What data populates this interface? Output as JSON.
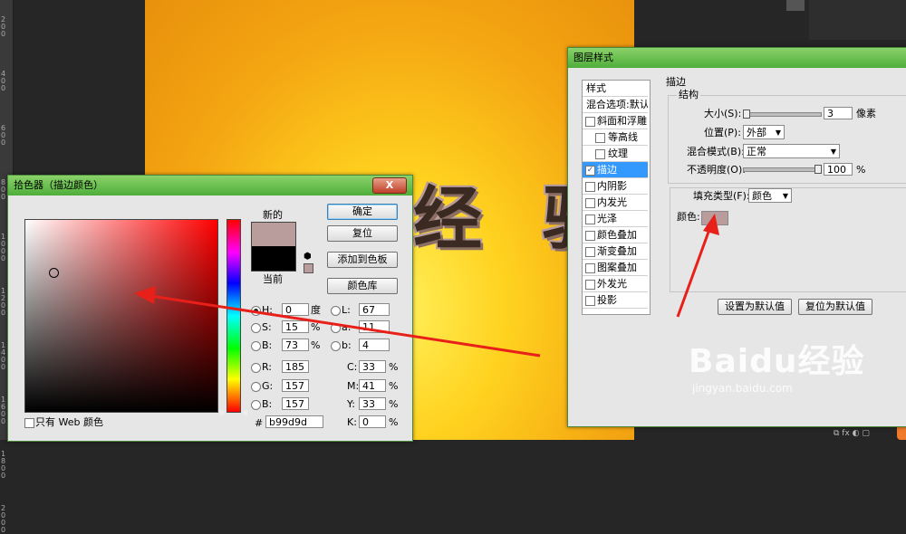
{
  "background": {
    "canvas_text": "经 验",
    "ruler_marks": [
      "200",
      "400",
      "600",
      "800",
      "1000",
      "1200",
      "1400",
      "1600",
      "1800",
      "2000"
    ],
    "watermark_main": "Baidu经验",
    "watermark_url": "jingyan.baidu.com"
  },
  "picker": {
    "title": "拾色器（描边颜色）",
    "close_label": "X",
    "new_label": "新的",
    "current_label": "当前",
    "new_color": "#b99d9d",
    "current_color": "#000000",
    "ok_label": "确定",
    "reset_label": "复位",
    "add_swatch_label": "添加到色板",
    "library_label": "颜色库",
    "web_only_label": "只有 Web 颜色",
    "hsb": [
      {
        "label": "H:",
        "value": "0",
        "unit": "度"
      },
      {
        "label": "S:",
        "value": "15",
        "unit": "%"
      },
      {
        "label": "B:",
        "value": "73",
        "unit": "%"
      }
    ],
    "rgb": [
      {
        "label": "R:",
        "value": "185"
      },
      {
        "label": "G:",
        "value": "157"
      },
      {
        "label": "B:",
        "value": "157"
      }
    ],
    "lab": [
      {
        "label": "L:",
        "value": "67"
      },
      {
        "label": "a:",
        "value": "11"
      },
      {
        "label": "b:",
        "value": "4"
      }
    ],
    "cmyk": [
      {
        "label": "C:",
        "value": "33",
        "unit": "%"
      },
      {
        "label": "M:",
        "value": "41",
        "unit": "%"
      },
      {
        "label": "Y:",
        "value": "33",
        "unit": "%"
      },
      {
        "label": "K:",
        "value": "0",
        "unit": "%"
      }
    ],
    "hex_label": "#",
    "hex_value": "b99d9d"
  },
  "layer_style": {
    "title": "图层样式",
    "sidebar_header": "样式",
    "blend_options": "混合选项:默认",
    "effects": [
      {
        "label": "斜面和浮雕",
        "checked": false,
        "indent": false
      },
      {
        "label": "等高线",
        "checked": false,
        "indent": true
      },
      {
        "label": "纹理",
        "checked": false,
        "indent": true
      },
      {
        "label": "描边",
        "checked": true,
        "indent": false
      },
      {
        "label": "内阴影",
        "checked": false,
        "indent": false
      },
      {
        "label": "内发光",
        "checked": false,
        "indent": false
      },
      {
        "label": "光泽",
        "checked": false,
        "indent": false
      },
      {
        "label": "颜色叠加",
        "checked": false,
        "indent": false
      },
      {
        "label": "渐变叠加",
        "checked": false,
        "indent": false
      },
      {
        "label": "图案叠加",
        "checked": false,
        "indent": false
      },
      {
        "label": "外发光",
        "checked": false,
        "indent": false
      },
      {
        "label": "投影",
        "checked": false,
        "indent": false
      }
    ],
    "section_title": "描边",
    "structure_title": "结构",
    "size_label": "大小(S):",
    "size_value": "3",
    "size_unit": "像素",
    "position_label": "位置(P):",
    "position_value": "外部",
    "blend_label": "混合模式(B):",
    "blend_value": "正常",
    "opacity_label": "不透明度(O):",
    "opacity_value": "100",
    "opacity_unit": "%",
    "fill_type_label": "填充类型(F):",
    "fill_type_value": "颜色",
    "color_label": "颜色:",
    "stroke_color": "#b99d9d",
    "set_default_label": "设置为默认值",
    "reset_default_label": "复位为默认值"
  },
  "colors": {
    "titlebar_green": "#4fae3a",
    "annotation_red": "#e8201a",
    "selection_blue": "#3399ff"
  }
}
